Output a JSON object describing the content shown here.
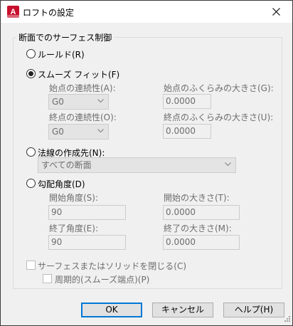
{
  "window": {
    "title": "ロフトの設定",
    "icon": "autocad-a-icon",
    "accent_color": "#c8102e"
  },
  "group": {
    "title": "断面でのサーフェス制御"
  },
  "ruled": {
    "label": "ルールド(R)",
    "checked": false
  },
  "smooth_fit": {
    "label": "スムーズ フィット(F)",
    "checked": true,
    "start_continuity_label": "始点の連続性(A):",
    "start_continuity_value": "G0",
    "start_bulge_label": "始点のふくらみの大きさ(G):",
    "start_bulge_value": "0.0000",
    "end_continuity_label": "終点の連続性(O):",
    "end_continuity_value": "G0",
    "end_bulge_label": "終点のふくらみの大きさ(U):",
    "end_bulge_value": "0.0000"
  },
  "normal_to": {
    "label": "法線の作成先(N):",
    "checked": false,
    "select_value": "すべての断面"
  },
  "draft": {
    "label": "勾配角度(D)",
    "checked": false,
    "start_angle_label": "開始角度(S):",
    "start_angle_value": "90",
    "start_magnitude_label": "開始の大きさ(T):",
    "start_magnitude_value": "0.0000",
    "end_angle_label": "終了角度(E):",
    "end_angle_value": "90",
    "end_magnitude_label": "終了の大きさ(M):",
    "end_magnitude_value": "0.0000"
  },
  "close_surface": {
    "label": "サーフェスまたはソリッドを閉じる(C)",
    "checked": false
  },
  "periodic": {
    "label": "周期的(スムーズ端点)(P)",
    "checked": false
  },
  "buttons": {
    "ok": "OK",
    "cancel": "キャンセル",
    "help": "ヘルプ(H)"
  }
}
